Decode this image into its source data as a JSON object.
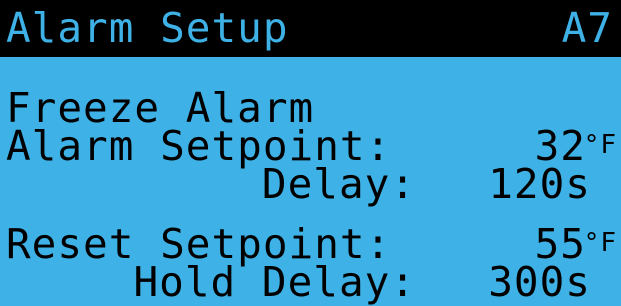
{
  "header": {
    "title": "Alarm Setup",
    "screen_id": "A7"
  },
  "freeze_alarm": {
    "heading": "Freeze Alarm",
    "alarm_setpoint_label": "Alarm Setpoint:",
    "alarm_setpoint_value": "32",
    "alarm_setpoint_unit": "°F",
    "delay_label": "Delay:",
    "delay_value": "120s"
  },
  "reset": {
    "reset_setpoint_label": "Reset Setpoint:",
    "reset_setpoint_value": "55",
    "reset_setpoint_unit": "°F",
    "hold_delay_label": "Hold Delay:",
    "hold_delay_value": "300s"
  },
  "colors": {
    "background": "#3eb2e6",
    "foreground": "#000000"
  }
}
